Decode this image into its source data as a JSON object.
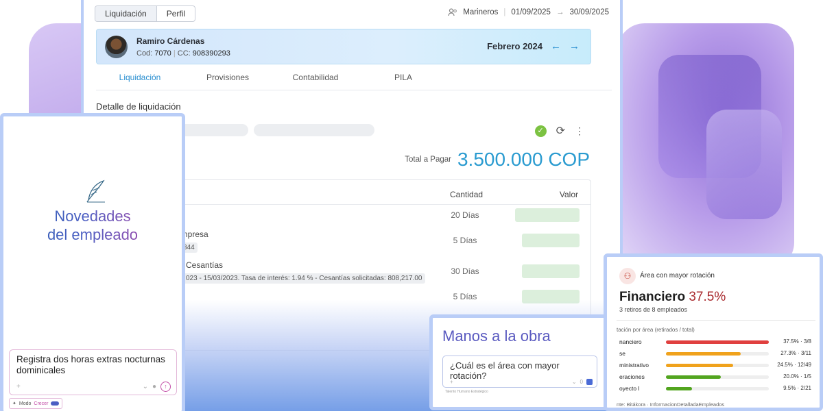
{
  "main": {
    "segment": [
      "Liquidación",
      "Perfil"
    ],
    "context": "Marineros",
    "date_from": "01/09/2025",
    "date_to": "30/09/2025",
    "employee": {
      "name": "Ramiro Cárdenas",
      "cod_label": "Cod:",
      "cod": "7070",
      "cc_label": "CC:",
      "cc": "908390293"
    },
    "period": "Febrero 2024",
    "tabs": [
      "Liquidación",
      "Provisiones",
      "Contabilidad",
      "PILA"
    ],
    "section_title": "Detalle de liquidación",
    "total_label": "Total a Pagar",
    "total_value": "3.500.000 COP",
    "table": {
      "headers": {
        "qty": "Cantidad",
        "value": "Valor"
      },
      "rows": [
        {
          "text": "",
          "sub": "",
          "qty": "20 Días"
        },
        {
          "text": "npresa",
          "sub": "344",
          "qty": "5 Días"
        },
        {
          "text": "Cesantías",
          "sub": "023 - 15/03/2023. Tasa de interés: 1.94 % - Cesantías solicitadas: 808,217.00",
          "qty": "30 Días"
        },
        {
          "text": "",
          "sub": "",
          "qty": "5 Días"
        }
      ]
    }
  },
  "novedades": {
    "title_line1": "Novedades",
    "title_line2": "del empleado",
    "chat_text": "Registra dos horas extras nocturnas dominicales",
    "mode_label": "Modo",
    "mode_value": "Crecer"
  },
  "manos": {
    "title": "Manos a la obra",
    "question": "¿Cuál es el área con mayor rotación?",
    "note": "Talento Humano Estratégico"
  },
  "rotation": {
    "header": "Área con mayor rotación",
    "area": "Financiero",
    "pct": "37.5%",
    "sub": "3 retiros de 8 empleados",
    "axis_label": "tación por área (retirados / total)",
    "rows": [
      {
        "label": "nanciero",
        "pct": 0.375,
        "value": "37.5% · 3/8",
        "color": "#e0403f"
      },
      {
        "label": "se",
        "pct": 0.273,
        "value": "27.3% · 3/11",
        "color": "#f0a21c"
      },
      {
        "label": "ministrativo",
        "pct": 0.245,
        "value": "24.5% · 12/49",
        "color": "#f0a21c"
      },
      {
        "label": "eraciones",
        "pct": 0.2,
        "value": "20.0% · 1/5",
        "color": "#52a51f"
      },
      {
        "label": "oyecto I",
        "pct": 0.095,
        "value": "9.5% · 2/21",
        "color": "#52a51f"
      }
    ],
    "source": "nte: Bitákora · InformacionDetalladaEmpleados"
  }
}
